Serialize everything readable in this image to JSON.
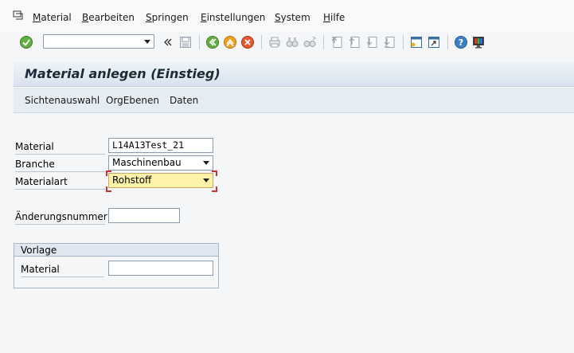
{
  "menubar": {
    "items": [
      "Material",
      "Bearbeiten",
      "Springen",
      "Einstellungen",
      "System",
      "Hilfe"
    ]
  },
  "toolbar": {
    "command_field_value": "",
    "icons": [
      "enter-icon",
      "save-icon",
      "back-icon",
      "exit-icon",
      "cancel-icon",
      "print-icon",
      "find-icon",
      "find-next-icon",
      "first-page-icon",
      "previous-page-icon",
      "next-page-icon",
      "last-page-icon",
      "new-session-icon",
      "shortcut-icon",
      "help-icon",
      "layout-menu-icon"
    ]
  },
  "screen": {
    "title": "Material anlegen (Einstieg)"
  },
  "app_toolbar": {
    "buttons": [
      "Sichtenauswahl",
      "OrgEbenen",
      "Daten"
    ]
  },
  "form": {
    "material_label": "Material",
    "material_value": "L14A13Test_21",
    "branche_label": "Branche",
    "branche_value": "Maschinenbau",
    "materialart_label": "Materialart",
    "materialart_value": "Rohstoff",
    "aenderungsnummer_label": "Änderungsnummer",
    "aenderungsnummer_value": ""
  },
  "vorlage": {
    "title": "Vorlage",
    "material_label": "Material",
    "material_value": ""
  },
  "colors": {
    "required_field": "#fdf2a8",
    "title_text": "#1c2a38"
  }
}
